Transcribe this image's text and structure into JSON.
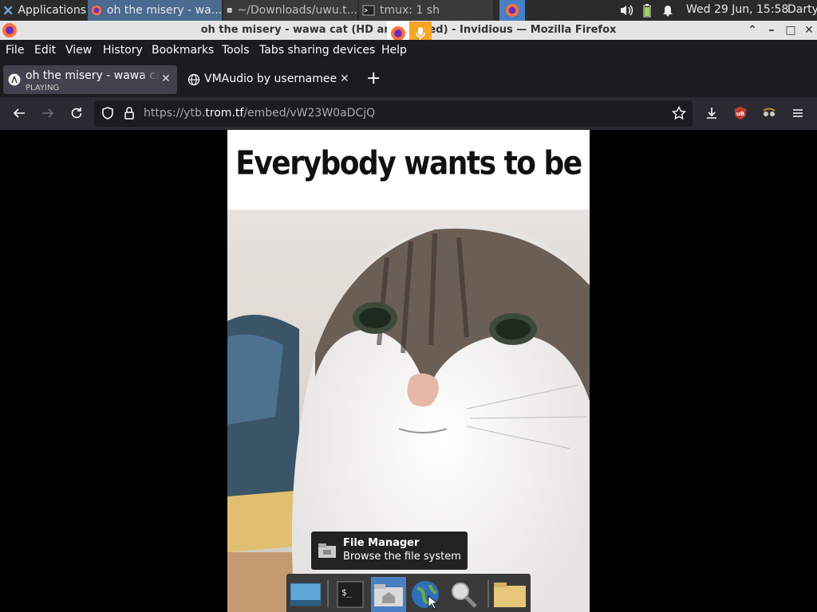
{
  "panel": {
    "applications_label": "Applications",
    "tasks": [
      {
        "label": "oh the misery - wa..."
      },
      {
        "label": "~/Downloads/uwu.t..."
      },
      {
        "label": "tmux: 1 sh"
      }
    ],
    "clock": "Wed 29 Jun, 15:58",
    "user": "Darty"
  },
  "window": {
    "title": "oh the misery - wawa cat (HD and synced) - Invidious — Mozilla Firefox"
  },
  "menubar": {
    "items": [
      "File",
      "Edit",
      "View",
      "History",
      "Bookmarks",
      "Tools",
      "Tabs sharing devices",
      "Help"
    ]
  },
  "tabs": [
    {
      "title": "oh the misery - wawa cat",
      "subtitle": "PLAYING",
      "active": true
    },
    {
      "title": "VMAudio by usernamee",
      "active": false
    }
  ],
  "navbar": {
    "url_prefix": "https://ytb.",
    "url_domain": "trom.tf",
    "url_path": "/embed/vW23W0aDCjQ"
  },
  "video": {
    "caption": "Everybody wants to be"
  },
  "tooltip": {
    "title": "File Manager",
    "subtitle": "Browse the file system"
  },
  "colors": {
    "accent": "#4a7fc4",
    "firefox_dark": "#1c1b22",
    "ublock_red": "#c0392b"
  }
}
